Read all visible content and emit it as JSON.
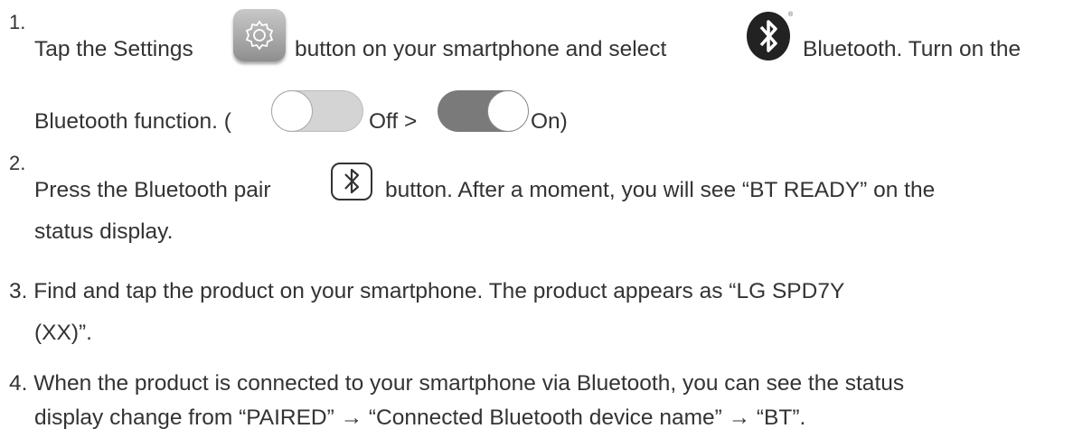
{
  "steps": [
    {
      "number": "1.",
      "line1": {
        "a": "Tap the Settings",
        "b": "button on your smartphone and select",
        "c": "Bluetooth. Turn on the"
      },
      "line2": {
        "a": "Bluetooth function. (",
        "b": "Off >",
        "c": "On)"
      },
      "icons": [
        "settings-gear-icon",
        "bluetooth-icon",
        "toggle-off-icon",
        "toggle-on-icon"
      ]
    },
    {
      "number": "2.",
      "line1": {
        "a": "Press the Bluetooth pair",
        "b": "button. After a moment, you will see “BT READY” on the"
      },
      "line2": "status display.",
      "icons": [
        "bluetooth-pair-button-icon"
      ]
    },
    {
      "line1": "3. Find and tap the product on your smartphone. The product appears as “LG SPD7Y",
      "line2": "(XX)”."
    },
    {
      "line1": "4. When the product is connected to your smartphone via Bluetooth, you can see the status",
      "line2": "display change from “PAIRED” → “Connected Bluetooth device name” → “BT”."
    }
  ],
  "colors": {
    "text": "#333333",
    "settings_icon_bg": "#a9a9a9",
    "toggle_off": "#d4d4d4",
    "toggle_on": "#7a7a7a"
  }
}
